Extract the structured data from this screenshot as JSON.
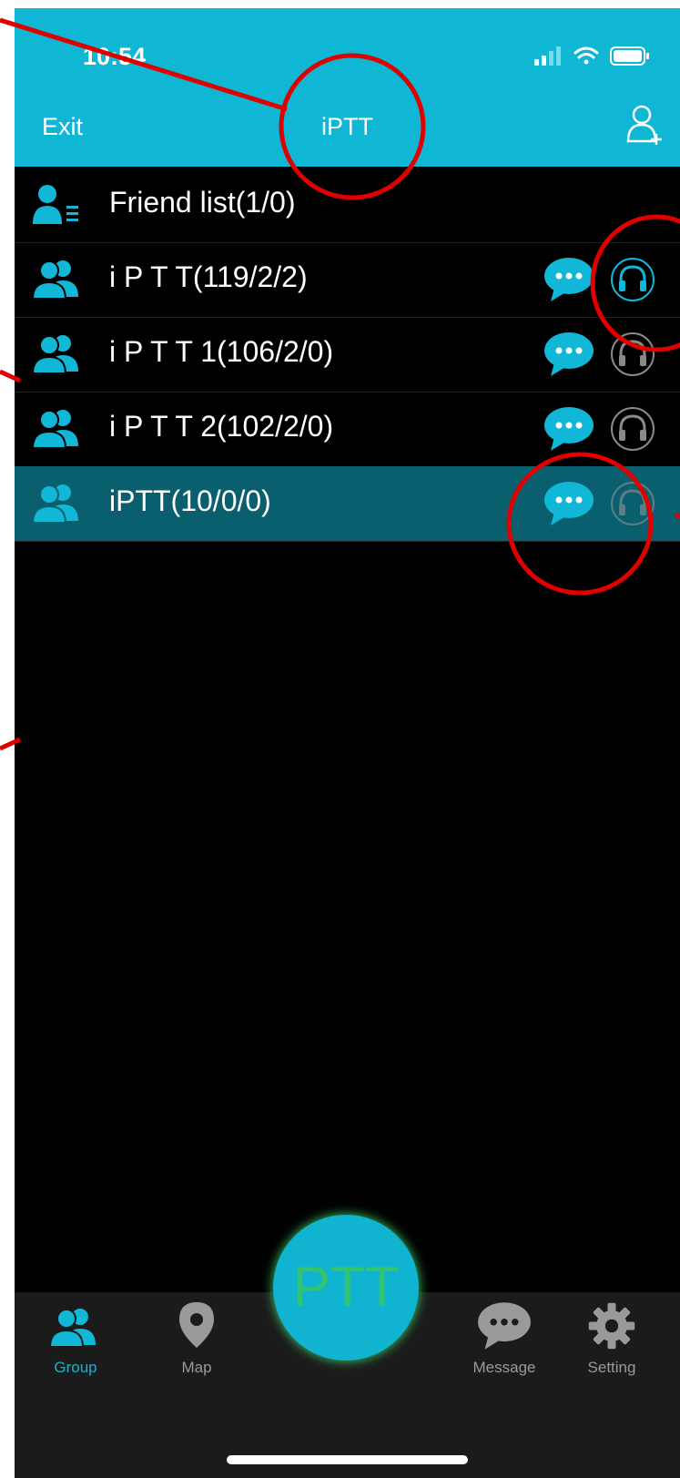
{
  "status_bar": {
    "time": "10:54"
  },
  "header": {
    "exit_label": "Exit",
    "title": "iPTT",
    "add_user_icon": "add-user-icon"
  },
  "friend_list": {
    "label": "Friend list(1/0)",
    "icon": "contact-list-icon"
  },
  "groups": [
    {
      "label": "i P T T(119/2/2)",
      "headset_active": true
    },
    {
      "label": "i P T T 1(106/2/0)",
      "headset_active": false
    },
    {
      "label": "i P T T 2(102/2/0)",
      "headset_active": false
    },
    {
      "label": "iPTT(10/0/0)",
      "headset_active": false,
      "selected": true
    }
  ],
  "ptt_button": {
    "label": "PTT"
  },
  "tabs": [
    {
      "label": "Group",
      "icon": "group-icon",
      "active": true
    },
    {
      "label": "Map",
      "icon": "map-pin-icon",
      "active": false
    },
    {
      "label": "Message",
      "icon": "message-icon",
      "active": false
    },
    {
      "label": "Setting",
      "icon": "gear-icon",
      "active": false
    }
  ],
  "colors": {
    "accent": "#0fb7d4",
    "selected_row": "#0a5f6e",
    "annotation": "#e00000",
    "ptt_text": "#33c46e"
  }
}
